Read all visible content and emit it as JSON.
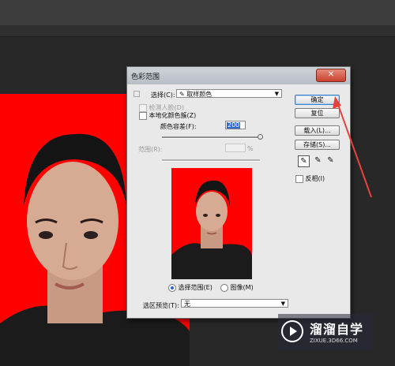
{
  "dialog": {
    "title": "色彩范围",
    "close_glyph": "✕",
    "select_label": "选择(C):",
    "select_value": "取样颜色",
    "detect_faces": "检测人脸(D)",
    "localized_clusters": "本地化颜色簇(Z)",
    "fuzziness_label": "颜色容差(F):",
    "fuzziness_value": "200",
    "range_label": "范围(R):",
    "range_unit": "%",
    "radio_selection": "选择范围(E)",
    "radio_image": "图像(M)",
    "preview_label": "选区预览(T):",
    "preview_value": "无",
    "ok_label": "确定",
    "reset_label": "复位",
    "load_label": "载入(L)...",
    "save_label": "存储(S)...",
    "invert_label": "反相(I)"
  },
  "watermark": {
    "title": "溜溜自学",
    "subtitle": "ZIXUE.3D66.COM"
  },
  "colors": {
    "canvas_red": "#fe0000",
    "dialog_bg": "#e9e9e9",
    "accent": "#2e6ad0",
    "arrow_red": "#e8433a"
  }
}
